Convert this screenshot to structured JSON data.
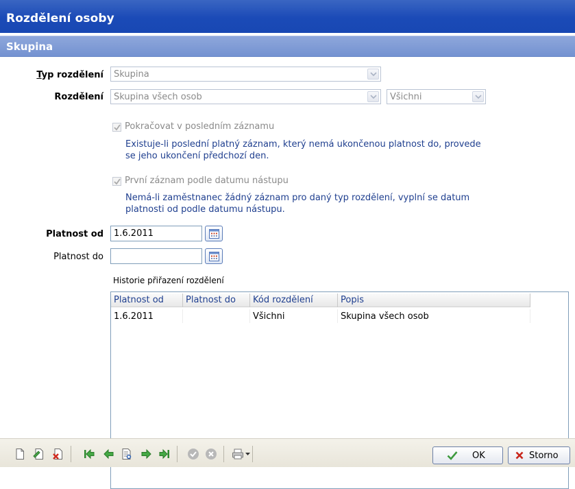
{
  "window": {
    "title": "Rozdělení osoby"
  },
  "section": {
    "title": "Skupina"
  },
  "form": {
    "typ_label_first": "T",
    "typ_label_rest": "yp rozdělení",
    "typ_value": "Skupina",
    "rozdeleni_label": "Rozdělení",
    "rozdeleni_value": "Skupina všech osob",
    "rozdeleni_sub_value": "Všichni",
    "chk1_label": "Pokračovat v posledním záznamu",
    "chk1_desc_line1": "Existuje-li poslední platný záznam, který nemá ukončenou platnost do, provede",
    "chk1_desc_line2": "se jeho ukončení předchozí den.",
    "chk2_label": "První záznam podle datumu nástupu",
    "chk2_desc_line1": "Nemá-li zaměstnanec žádný záznam pro daný typ rozdělení, vyplní se datum",
    "chk2_desc_line2": "platnosti od podle datumu nástupu.",
    "platnost_od_label": "Platnost od",
    "platnost_od_value": "1.6.2011",
    "platnost_do_label": "Platnost do",
    "platnost_do_value": ""
  },
  "history": {
    "caption": "Historie přiřazení rozdělení",
    "columns": [
      "Platnost od",
      "Platnost do",
      "Kód rozdělení",
      "Popis"
    ],
    "rows": [
      [
        "1.6.2011",
        "",
        "Všichni",
        "Skupina všech osob"
      ]
    ]
  },
  "toolbar": {
    "ok_label": "OK",
    "cancel_label": "Storno"
  },
  "colors": {
    "title_bar": "#1b4ab7",
    "section_bar": "#7f9bd6",
    "description_text": "#1f3f8f"
  }
}
